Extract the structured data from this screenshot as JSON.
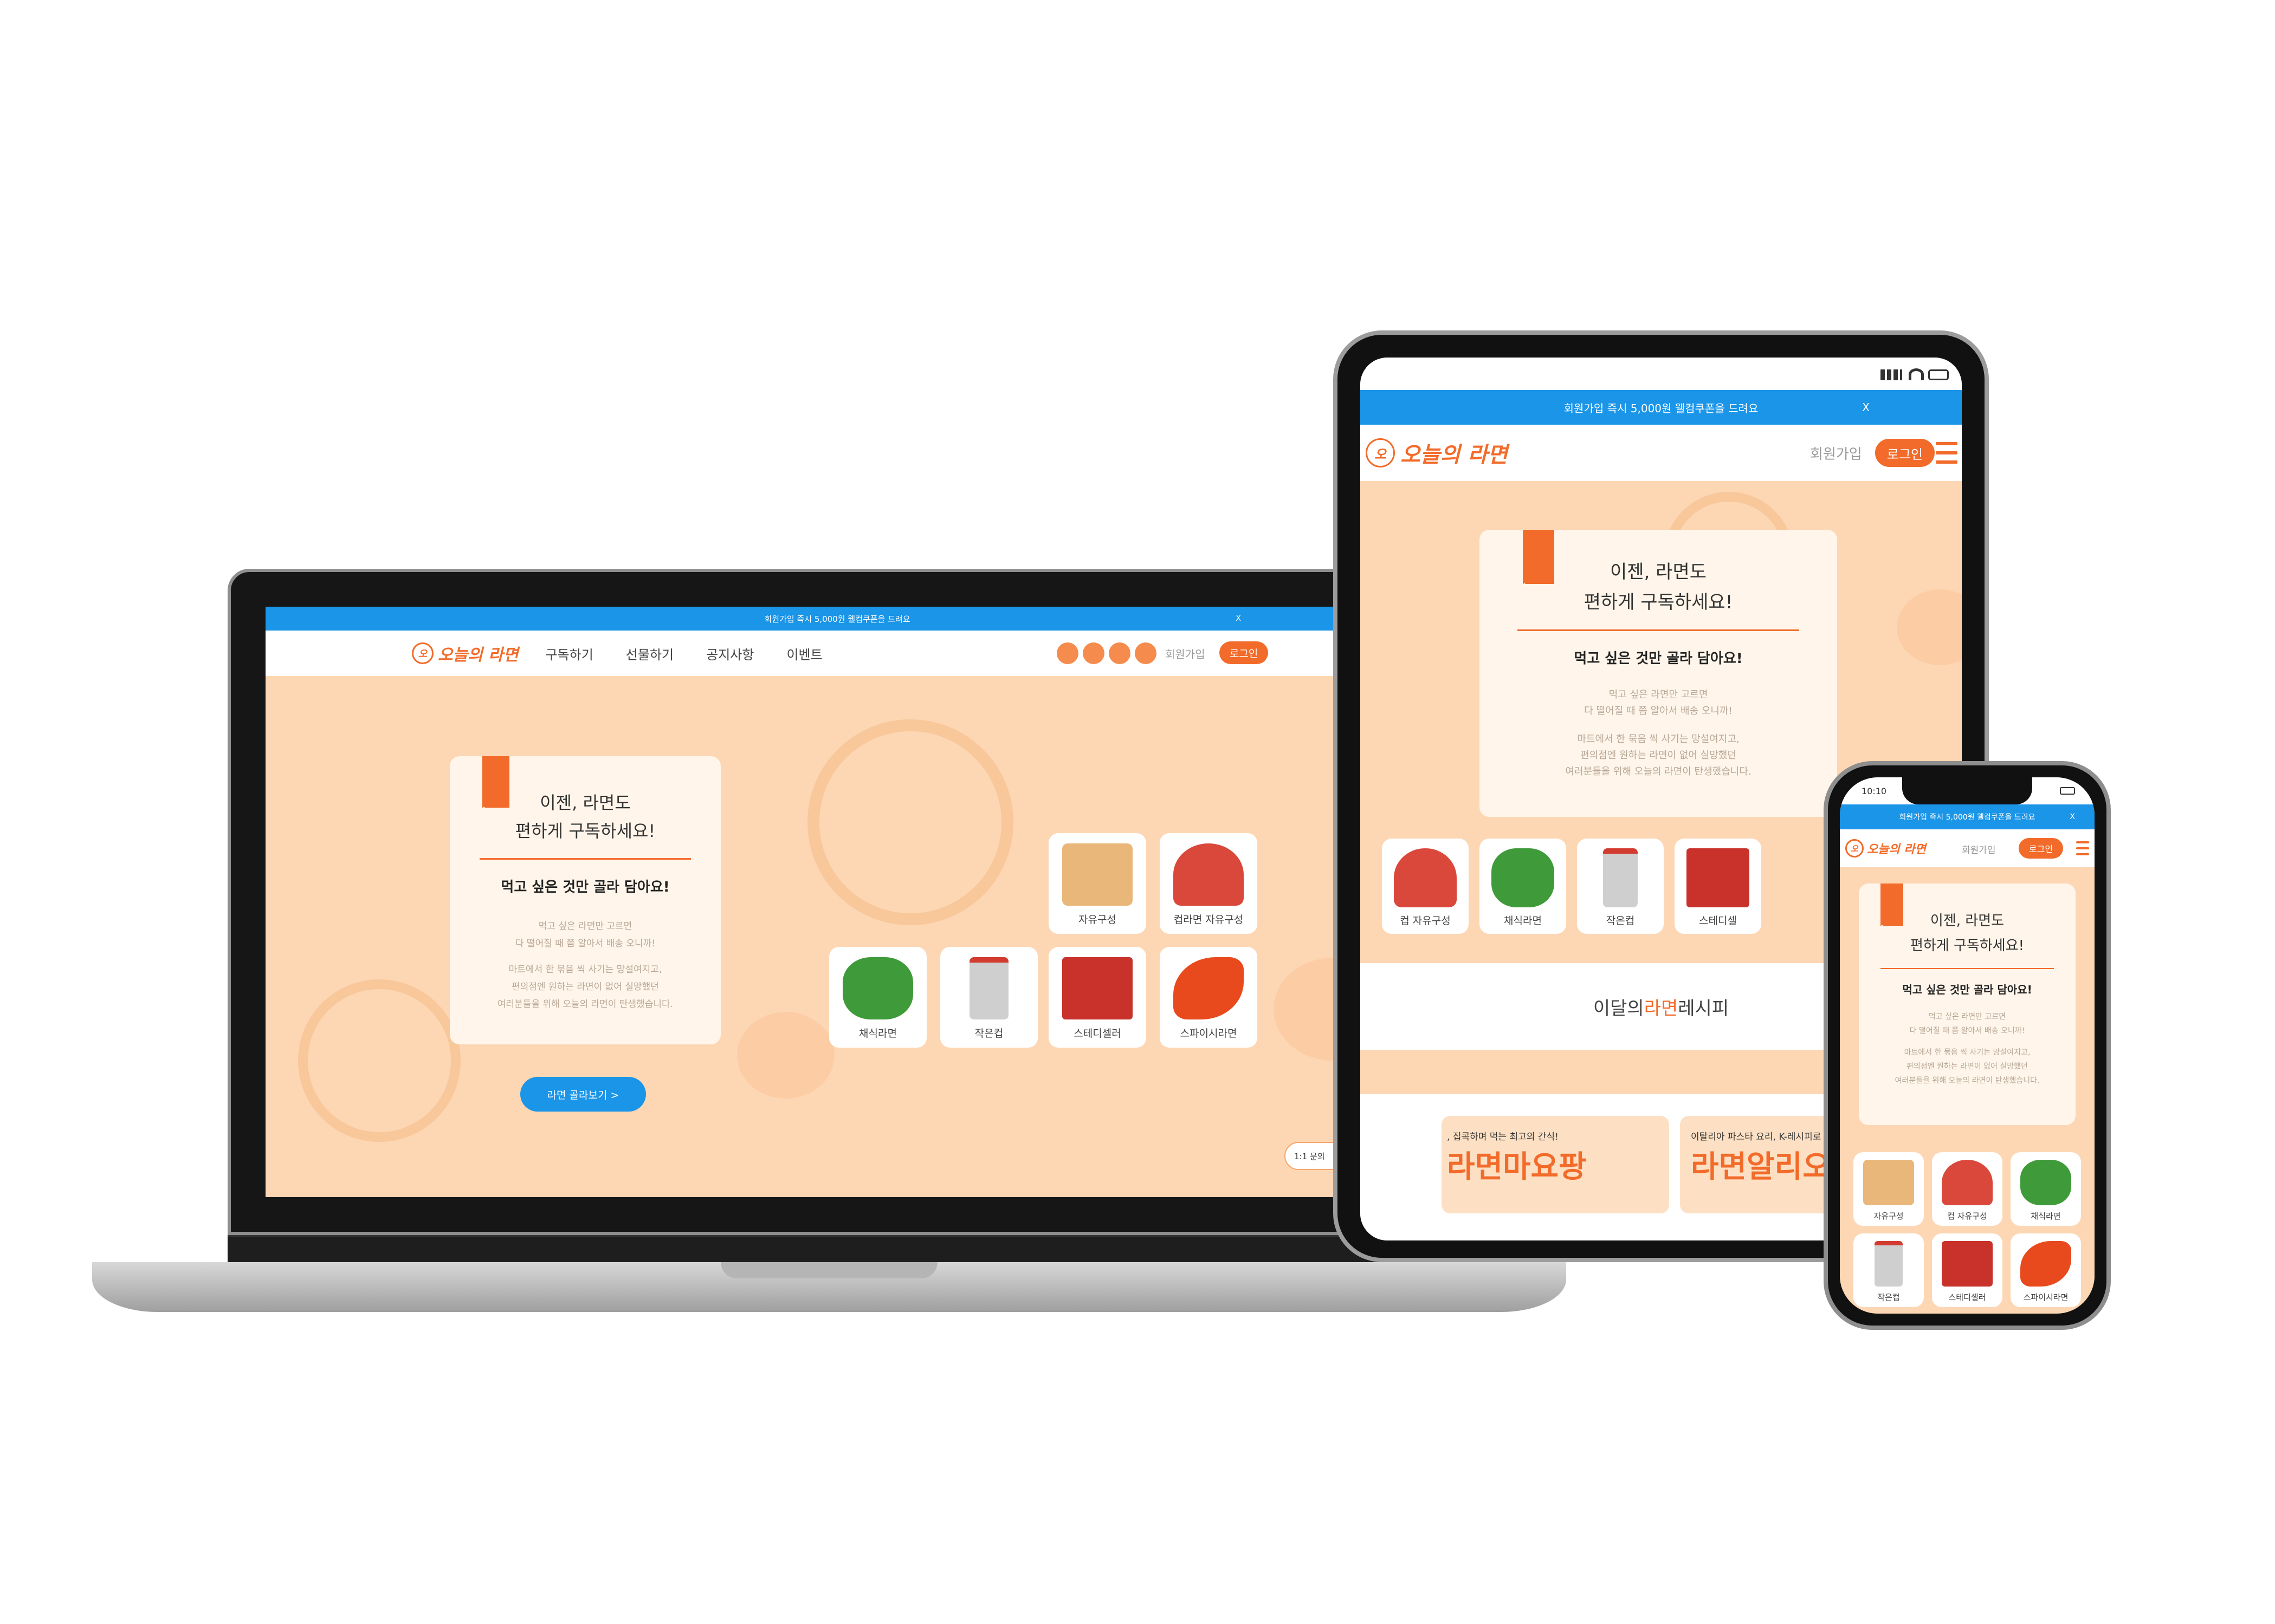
{
  "banner": {
    "text": "회원가입 즉시 5,000원 웰컴쿠폰을 드려요",
    "close": "X"
  },
  "logo": {
    "mark": "오",
    "text": "오늘의 라면"
  },
  "nav": [
    {
      "label": "구독하기"
    },
    {
      "label": "선물하기"
    },
    {
      "label": "공지사항"
    },
    {
      "label": "이벤트"
    }
  ],
  "social": [
    "instagram-icon",
    "blog-icon",
    "kakao-icon",
    "youtube-icon"
  ],
  "auth": {
    "join": "회원가입",
    "login": "로그인"
  },
  "hero": {
    "title_line1": "이젠, 라면도",
    "title_line2": "편하게 구독하세요!",
    "subtitle": "먹고 싶은 것만 골라 담아요!",
    "desc1_line1": "먹고 싶은 라면만 고르면",
    "desc1_line2": "다 떨어질 때 쯤 알아서 배송 오니까!",
    "desc2_line1": "마트에서 한 묶음 씩 사기는 망설여지고,",
    "desc2_line2": "편의점엔 원하는 라면이 없어 실망했던",
    "desc2_line3": "여러분들을 위해 오늘의 라면이 탄생했습니다."
  },
  "cta": {
    "label": "라면 골라보기 >"
  },
  "chat": {
    "label": "1:1 문의"
  },
  "categories": [
    {
      "label": "자유구성",
      "color": "#e9b77a"
    },
    {
      "label": "컵라면 자유구성",
      "color": "#d9483b"
    },
    {
      "label": "채식라면",
      "color": "#3f9a3a"
    },
    {
      "label": "작은컵",
      "color": "#cfcfcf"
    },
    {
      "label": "스테디셀러",
      "color": "#c8322b"
    },
    {
      "label": "스파이시라면",
      "color": "#e84a1e"
    }
  ],
  "tablet_categories": [
    "컵 자유구성",
    "채식라면",
    "작은컵",
    "스테디셀"
  ],
  "recipe": {
    "title_pre": "이달의 ",
    "title_accent": "라면",
    "title_post": " 레시피",
    "card1_small": ", 집콕하며 먹는 최고의 간식!",
    "card1_big": "라면마요팡",
    "card2_small": "이탈리아 파스타 요리, K-레시피로",
    "card2_big": "라면알리오"
  },
  "phone": {
    "time": "10:10",
    "join": "회원가입",
    "cat_free": "컵 자유구성"
  },
  "colors": {
    "accent": "#f26b2a",
    "banner": "#1a95e8",
    "peach": "#fdd7b4",
    "card": "#fff5ea"
  }
}
